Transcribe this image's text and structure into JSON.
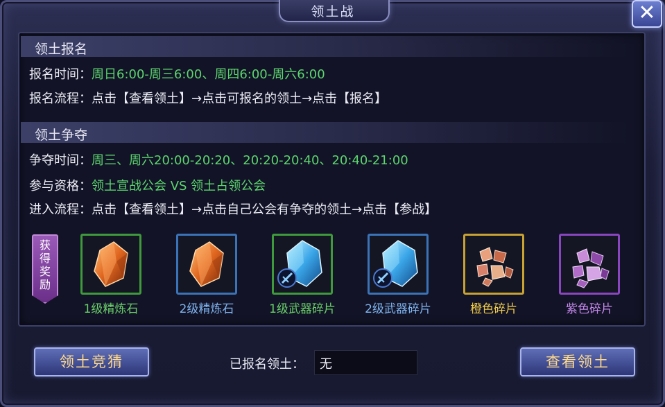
{
  "window": {
    "title": "领土战",
    "close_label": "✕"
  },
  "registration": {
    "heading": "领土报名",
    "time_label": "报名时间：",
    "time_value": "周日6:00-周三6:00、周四6:00-周六6:00",
    "flow_label": "报名流程：",
    "flow_value": "点击【查看领土】→点击可报名的领土→点击【报名】"
  },
  "contest": {
    "heading": "领土争夺",
    "time_label": "争夺时间：",
    "time_value": "周三、周六20:00-20:20、20:20-20:40、20:40-21:00",
    "qual_label": "参与资格：",
    "qual_value": "领土宣战公会 VS 领土占领公会",
    "flow_label": "进入流程：",
    "flow_value": "点击【查看领土】→点击自己公会有争夺的领土→点击【参战】"
  },
  "rewards": {
    "tag": "获得奖励",
    "items": [
      {
        "name": "1级精炼石",
        "icon": "orange-crystal-icon",
        "frame_color": "#3f9a3c",
        "name_color": "#6ad06a"
      },
      {
        "name": "2级精炼石",
        "icon": "orange-crystal-icon",
        "frame_color": "#3b73b8",
        "name_color": "#7fb4f0"
      },
      {
        "name": "1级武器碎片",
        "icon": "blue-crystal-sword-icon",
        "frame_color": "#3f9a3c",
        "name_color": "#6ad06a"
      },
      {
        "name": "2级武器碎片",
        "icon": "blue-crystal-sword-icon",
        "frame_color": "#3b73b8",
        "name_color": "#7fb4f0"
      },
      {
        "name": "橙色碎片",
        "icon": "orange-shards-icon",
        "frame_color": "#c9a234",
        "name_color": "#f0cc4a"
      },
      {
        "name": "紫色碎片",
        "icon": "purple-shards-icon",
        "frame_color": "#8a45c0",
        "name_color": "#c688ec"
      }
    ]
  },
  "footer": {
    "guess_button": "领土竞猜",
    "registered_label": "已报名领土：",
    "registered_value": "无",
    "view_button": "查看领土"
  },
  "colors": {
    "value_green": "#5cd66e",
    "button_text": "#ffd98a"
  }
}
